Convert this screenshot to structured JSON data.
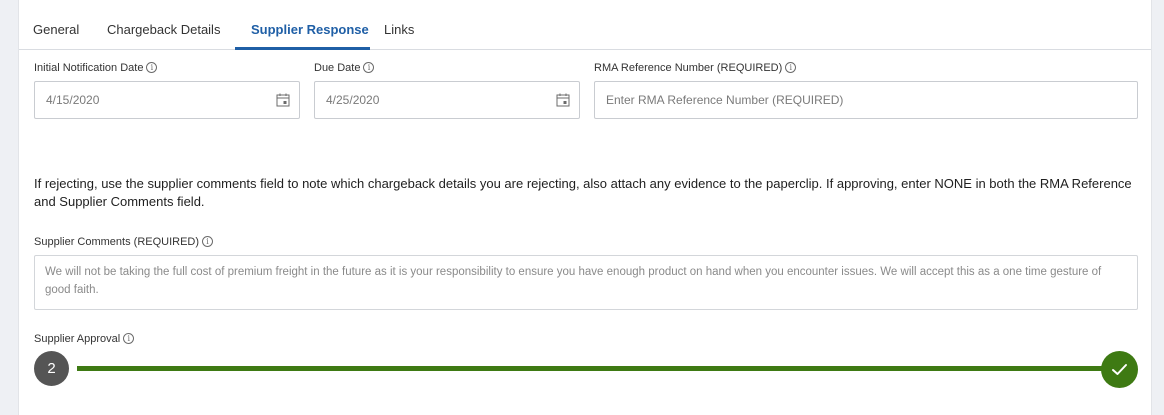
{
  "tabs": [
    {
      "label": "General",
      "active": false
    },
    {
      "label": "Chargeback Details",
      "active": false
    },
    {
      "label": "Supplier Response",
      "active": true
    },
    {
      "label": "Links",
      "active": false
    }
  ],
  "fields": {
    "initial_notification_date": {
      "label": "Initial Notification Date",
      "value": "4/15/2020"
    },
    "due_date": {
      "label": "Due Date",
      "value": "4/25/2020"
    },
    "rma_reference": {
      "label": "RMA Reference Number (REQUIRED)",
      "placeholder": "Enter RMA Reference Number (REQUIRED)"
    }
  },
  "instruction_text": "If rejecting, use the supplier comments field to note which chargeback details you are rejecting, also attach any evidence to the paperclip.  If approving, enter NONE in both the RMA Reference and Supplier Comments field.",
  "supplier_comments": {
    "label": "Supplier Comments (REQUIRED)",
    "value": "We will not be taking the full cost of premium freight in the future as it is your responsibility to ensure you have enough product on hand when you encounter issues. We will accept this as a one time gesture of good faith."
  },
  "supplier_approval": {
    "label": "Supplier Approval",
    "step_number": "2",
    "status": "approved"
  },
  "info_glyph": "i",
  "colors": {
    "accent_blue": "#1f5fa6",
    "approval_green": "#3e7a13",
    "step_gray": "#555555"
  }
}
